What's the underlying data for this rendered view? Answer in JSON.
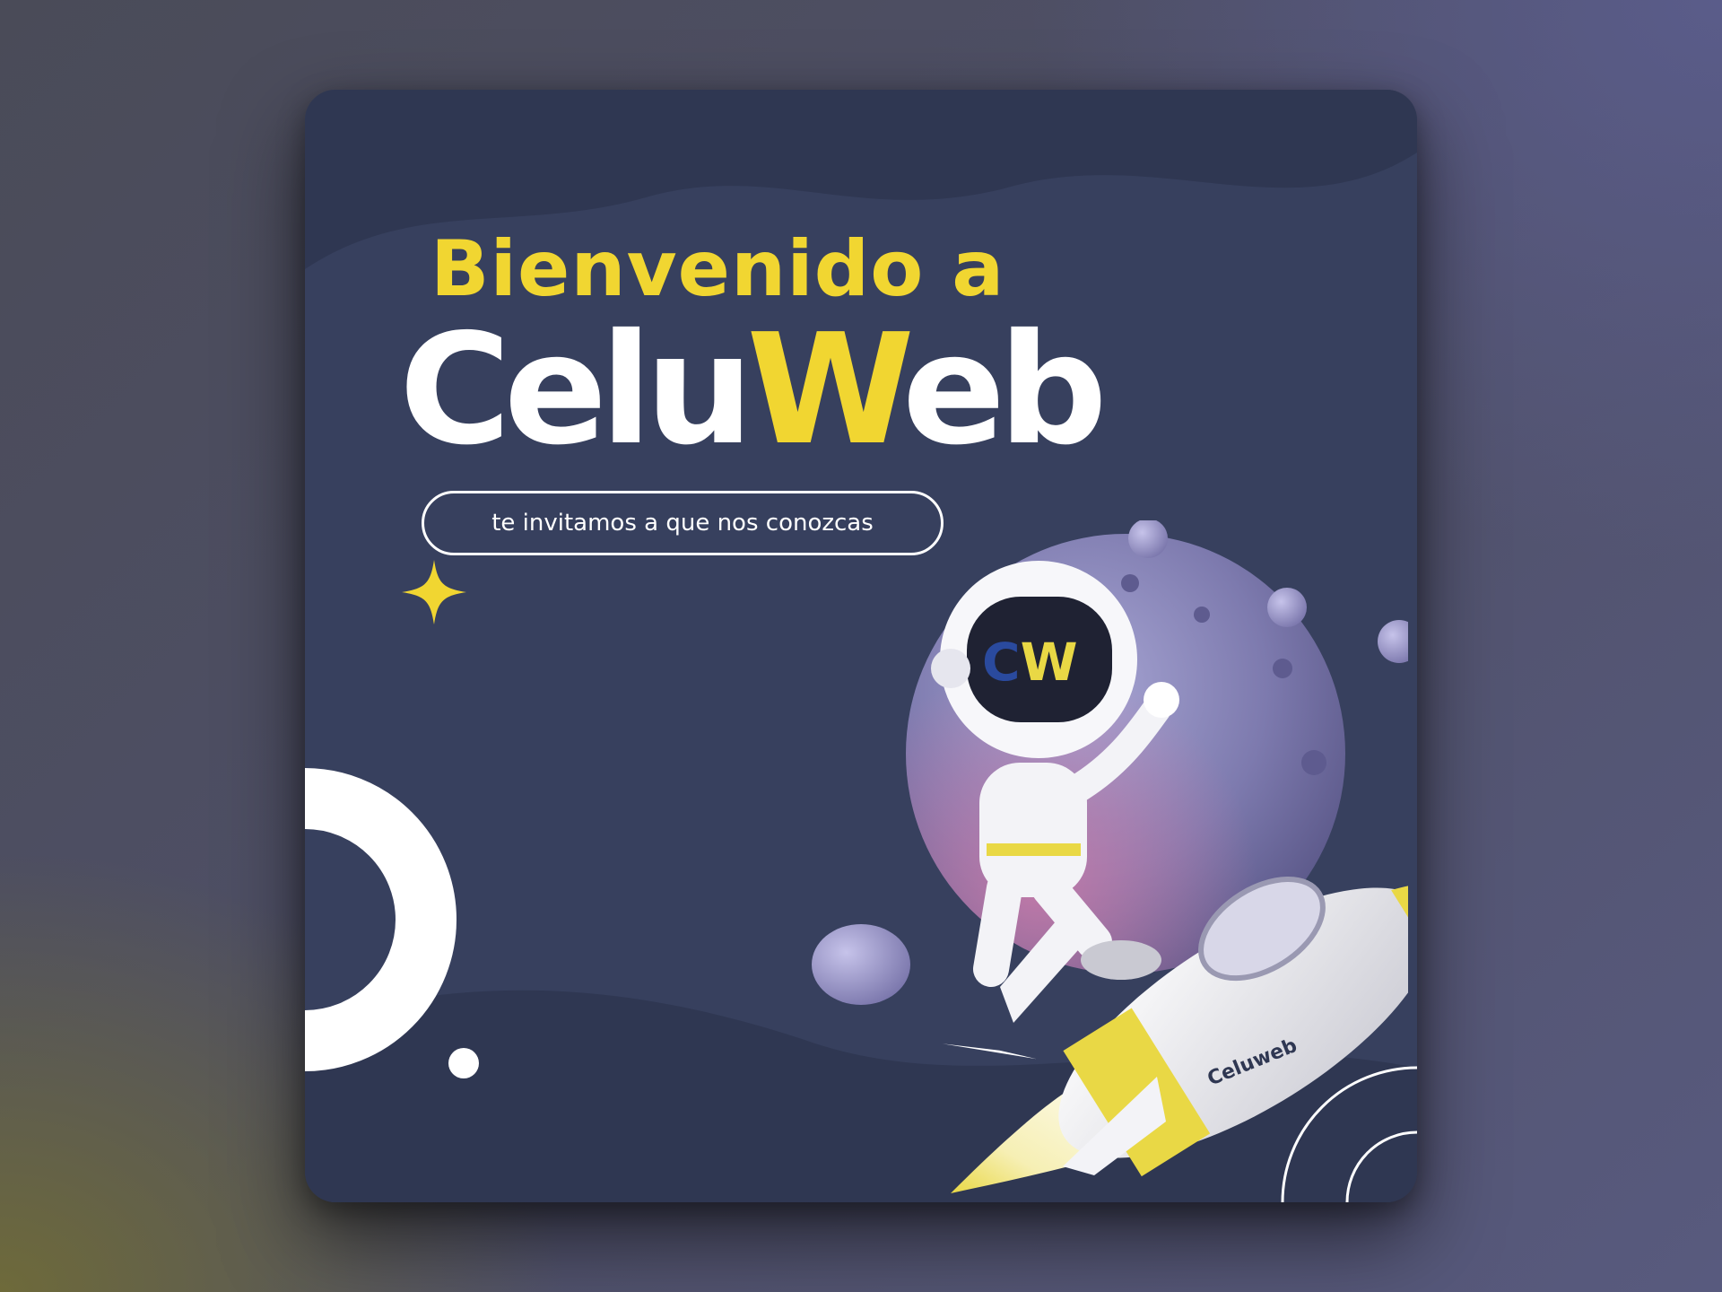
{
  "headline": "Bienvenido a",
  "brand": {
    "part1": "Celu",
    "part2": "W",
    "part3": "eb"
  },
  "tagline": "te invitamos a que nos conozcas",
  "rocket_label": "Celuweb",
  "helmet_logo": "CW",
  "colors": {
    "card": "#37405e",
    "yellow": "#f1d631",
    "white": "#ffffff"
  }
}
